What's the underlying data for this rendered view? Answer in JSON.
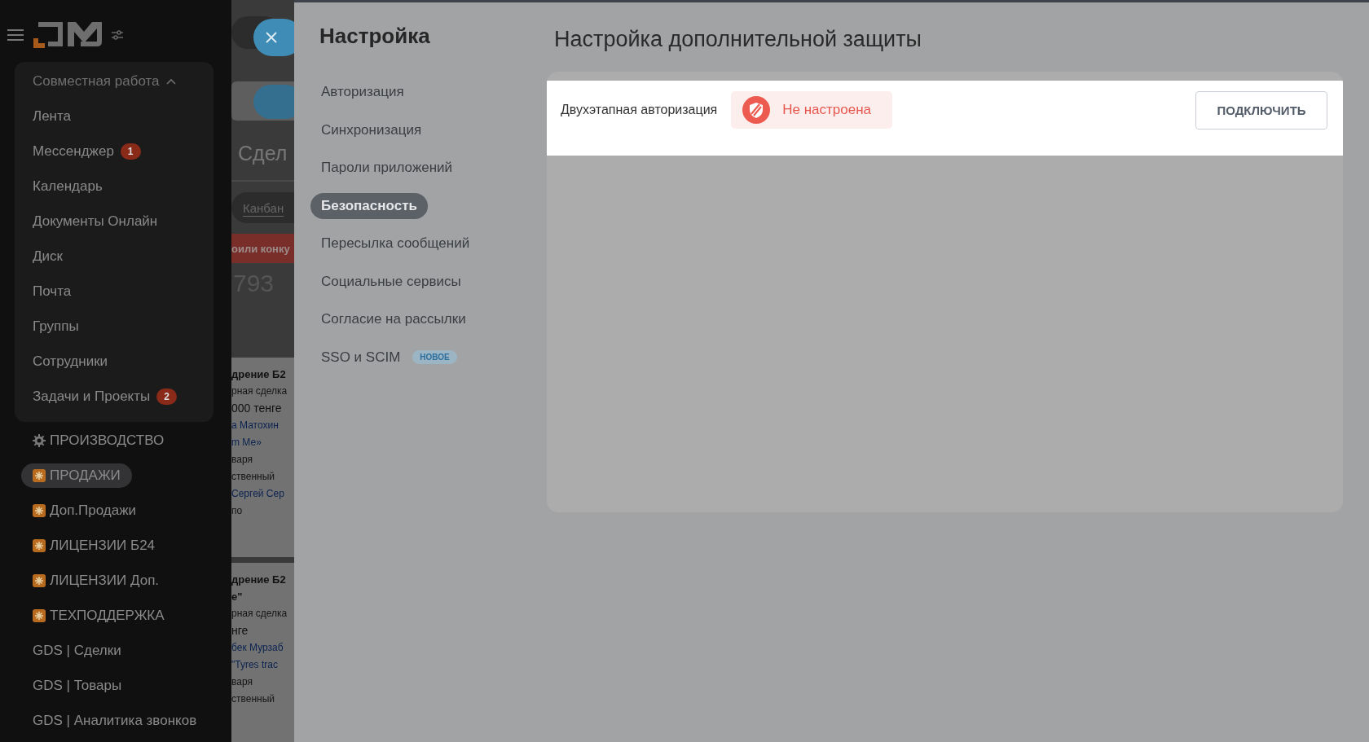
{
  "sidebar": {
    "group": {
      "title": "Совместная работа",
      "expanded": true,
      "items": [
        {
          "label": "Лента"
        },
        {
          "label": "Мессенджер",
          "counter": "1"
        },
        {
          "label": "Календарь"
        },
        {
          "label": "Документы Онлайн"
        },
        {
          "label": "Диск"
        },
        {
          "label": "Почта"
        },
        {
          "label": "Группы"
        },
        {
          "label": "Сотрудники"
        },
        {
          "label": "Задачи и Проекты",
          "counter": "2"
        }
      ]
    },
    "sections": [
      {
        "label": "ПРОИЗВОДСТВО",
        "kind": "gear",
        "selected": false
      },
      {
        "label": "ПРОДАЖИ",
        "kind": "star",
        "selected": true
      },
      {
        "label": "Доп.Продажи",
        "kind": "star",
        "selected": false
      },
      {
        "label": "ЛИЦЕНЗИИ Б24",
        "kind": "star",
        "selected": false
      },
      {
        "label": "ЛИЦЕНЗИИ Доп.",
        "kind": "star",
        "selected": false
      },
      {
        "label": "ТЕХПОДДЕРЖКА",
        "kind": "star",
        "selected": false
      },
      {
        "label": "GDS | Сделки",
        "kind": "plain",
        "selected": false
      },
      {
        "label": "GDS | Товары",
        "kind": "plain",
        "selected": false
      },
      {
        "label": "GDS | Аналитика звонков",
        "kind": "plain",
        "selected": false
      }
    ]
  },
  "background_page": {
    "title": "Сдел",
    "view_tab": "Канбан",
    "banner": "оили конку",
    "amount": "793",
    "cards": [
      {
        "lines": [
          {
            "kind": "title",
            "text": "дрение Б2"
          },
          {
            "kind": "sub",
            "text": "рная сделка"
          },
          {
            "kind": "text",
            "text": "000 тенге"
          },
          {
            "kind": "link",
            "text": "а Матохин"
          },
          {
            "kind": "link",
            "text": "m Ме»"
          },
          {
            "kind": "sub",
            "text": "варя"
          },
          {
            "kind": "sub",
            "text": "ственный"
          },
          {
            "kind": "link",
            "text": "Сергей Сер"
          },
          {
            "kind": "sub",
            "text": "по"
          }
        ]
      },
      {
        "lines": [
          {
            "kind": "title",
            "text": "дрение Б2"
          },
          {
            "kind": "title",
            "text": "е\""
          },
          {
            "kind": "sub",
            "text": "рная сделка"
          },
          {
            "kind": "text",
            "text": "нге"
          },
          {
            "kind": "link",
            "text": "бек Мурзаб"
          },
          {
            "kind": "link",
            "text": "\"Tyres trac"
          },
          {
            "kind": "sub",
            "text": "варя"
          },
          {
            "kind": "sub",
            "text": "ственный"
          }
        ]
      }
    ]
  },
  "settings": {
    "title": "Настройка",
    "nav": [
      {
        "label": "Авторизация",
        "selected": false
      },
      {
        "label": "Синхронизация",
        "selected": false
      },
      {
        "label": "Пароли приложений",
        "selected": false
      },
      {
        "label": "Безопасность",
        "selected": true
      },
      {
        "label": "Пересылка сообщений",
        "selected": false
      },
      {
        "label": "Социальные сервисы",
        "selected": false
      },
      {
        "label": "Согласие на рассылки",
        "selected": false
      },
      {
        "label": "SSO и SCIM",
        "selected": false,
        "badge": "НОВОЕ"
      }
    ],
    "heading": "Настройка дополнительной защиты",
    "rows": [
      {
        "label": "Двухэтапная авторизация",
        "status": "Не настроена",
        "configured": false,
        "button": "ПОДКЛЮЧИТЬ"
      }
    ]
  }
}
